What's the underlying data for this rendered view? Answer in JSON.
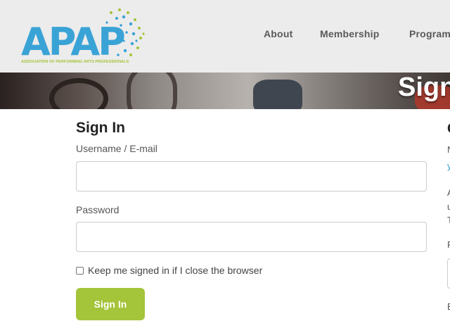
{
  "header": {
    "logo_text": "APAP",
    "logo_tagline": "ASSOCIATION OF PERFORMING ARTS PROFESSIONALS",
    "nav": [
      "About",
      "Membership",
      "Programs"
    ]
  },
  "banner": {
    "title": "Sign"
  },
  "signin": {
    "heading": "Sign In",
    "username_label": "Username / E-mail",
    "password_label": "Password",
    "keep_signed_in": "Keep me signed in if I close the browser",
    "button": "Sign In"
  },
  "right_column": {
    "heading": "C",
    "lines": [
      "N",
      "y",
      "A",
      "u",
      "T",
      "F",
      "E"
    ]
  },
  "colors": {
    "brand_blue": "#3aa3d6",
    "brand_green": "#a4c43a",
    "header_bg": "#ececec"
  }
}
